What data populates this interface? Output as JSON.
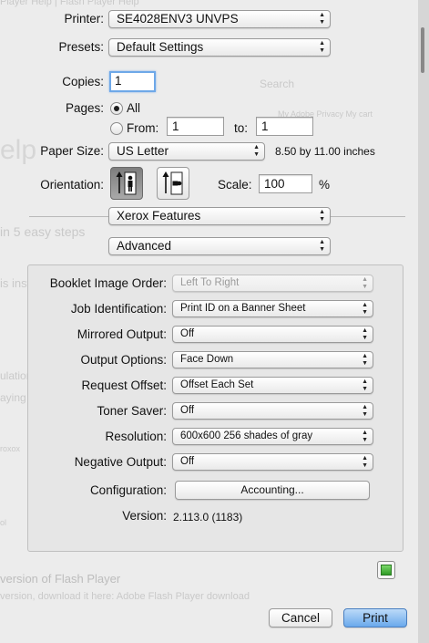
{
  "printer": {
    "label": "Printer:",
    "value": "SE4028ENV3 UNVPS"
  },
  "presets": {
    "label": "Presets:",
    "value": "Default Settings"
  },
  "copies": {
    "label": "Copies:",
    "value": "1"
  },
  "pages": {
    "label": "Pages:",
    "all_label": "All",
    "from_label": "From:",
    "from_value": "1",
    "to_label": "to:",
    "to_value": "1",
    "selected": "All"
  },
  "paper_size": {
    "label": "Paper Size:",
    "value": "US Letter",
    "dimensions": "8.50 by 11.00 inches"
  },
  "orientation": {
    "label": "Orientation:",
    "selected": "portrait"
  },
  "scale": {
    "label": "Scale:",
    "value": "100",
    "unit": "%"
  },
  "section_menu": {
    "value": "Xerox Features"
  },
  "sub_menu": {
    "value": "Advanced"
  },
  "settings": [
    {
      "label": "Booklet Image Order:",
      "value": "Left To Right",
      "enabled": false
    },
    {
      "label": "Job Identification:",
      "value": "Print ID on a Banner Sheet",
      "enabled": true
    },
    {
      "label": "Mirrored Output:",
      "value": "Off",
      "enabled": true
    },
    {
      "label": "Output Options:",
      "value": "Face Down",
      "enabled": true
    },
    {
      "label": "Request Offset:",
      "value": "Offset Each Set",
      "enabled": true
    },
    {
      "label": "Toner Saver:",
      "value": "Off",
      "enabled": true
    },
    {
      "label": "Resolution:",
      "value": "600x600 256 shades of gray",
      "enabled": true
    },
    {
      "label": "Negative Output:",
      "value": "Off",
      "enabled": true
    }
  ],
  "configuration": {
    "label": "Configuration:",
    "button": "Accounting..."
  },
  "version": {
    "label": "Version:",
    "value": "2.113.0 (1183)"
  },
  "buttons": {
    "cancel": "Cancel",
    "print": "Print"
  },
  "background_page": {
    "title": "Player Help | Flash Player Help",
    "search": "Search",
    "nav": "My Adobe   Privacy   My cart",
    "heading": "elp",
    "steps": "in 5 easy steps",
    "install": "is install",
    "congrats": "ulations, your",
    "games": "aying games, watching",
    "row1": "roxox",
    "row2": "ol",
    "version_heading": "version of Flash Player",
    "version_link": "version, download it here: Adobe Flash Player download"
  },
  "colors": {
    "default_button": "#6aa9ec",
    "focus_ring": "#6ea8e8",
    "status_indicator": "#2f9a25"
  }
}
